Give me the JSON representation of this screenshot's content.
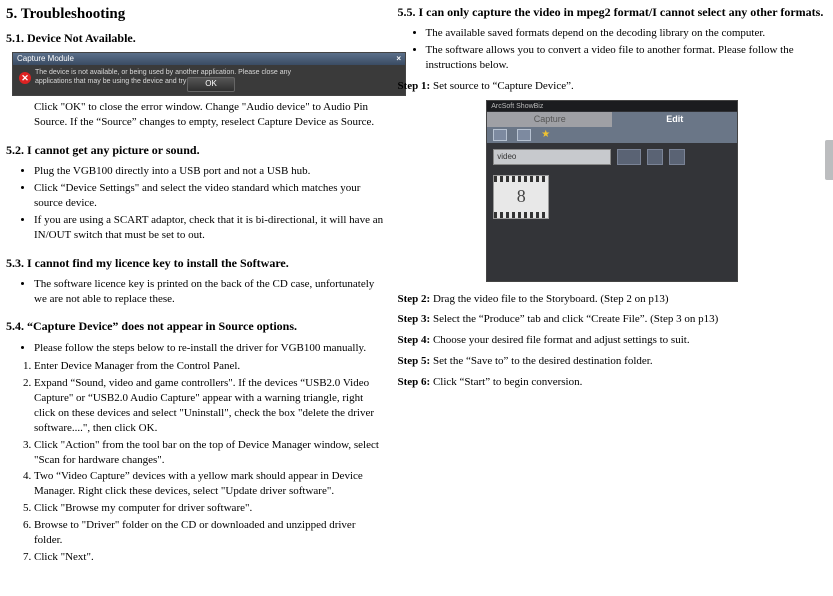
{
  "chapter_title": "5. Troubleshooting",
  "s51": {
    "heading": "5.1. Device Not Available.",
    "shot": {
      "title": "Capture Module",
      "msg_text": "The device is not available, or being used by another application. Please close any applications that may be using the device and try again.",
      "ok": "OK"
    },
    "text": "Click \"OK\" to close the error window. Change \"Audio device\" to Audio Pin Source. If the “Source” changes to empty, reselect Capture Device as Source."
  },
  "s52": {
    "heading": "5.2. I cannot get any picture or sound.",
    "b1": "Plug the VGB100 directly into a USB port and not a USB hub.",
    "b2": "Click “Device Settings\" and select the video standard which matches your source device.",
    "b3": "If you are using a SCART adaptor, check that it is bi-directional, it will have an IN/OUT switch that must be set to out."
  },
  "s53": {
    "heading": "5.3. I cannot find my licence key to install the Software.",
    "b1": "The software licence key is printed on the back of the CD case, unfortunately we are not able to replace these."
  },
  "s54": {
    "heading": "5.4. “Capture Device” does not appear in Source options.",
    "b1": "Please follow the steps below to re-install the driver for VGB100 manually.",
    "n1": "Enter Device Manager from the Control Panel.",
    "n2": "Expand “Sound, video and game controllers\". If the devices “USB2.0 Video Capture\" or “USB2.0 Audio Capture\" appear with a warning triangle, right click on these devices and select \"Uninstall\", check the box \"delete the driver software....\", then click OK.",
    "n3": "Click \"Action\" from the tool bar on the top of Device Manager window, select \"Scan for hardware changes\".",
    "n4": "Two “Video Capture” devices with a yellow mark should appear in Device Manager. Right click these devices, select \"Update driver software\".",
    "n5": "Click \"Browse my computer for driver software\".",
    "n6": "Browse to \"Driver\" folder on the CD or downloaded and unzipped driver folder.",
    "n7": "Click \"Next\"."
  },
  "s55": {
    "heading": "5.5. I can only capture the video in mpeg2 format/I cannot select any other formats.",
    "b1": "The available saved formats depend on the decoding library on the computer.",
    "b2": "The software allows you to convert a video file to another format. Please follow the instructions below.",
    "step1_label": "Step 1:",
    "step1_text": "Set source to “Capture Device”.",
    "app": {
      "title": "ArcSoft ShowBiz",
      "tab1": "Capture",
      "tab2": "Edit",
      "source_value": "video",
      "clip_number": "8"
    },
    "step2_label": "Step 2:",
    "step2_text": "Drag the video file to the Storyboard. (Step 2 on p13)",
    "step3_label": "Step 3:",
    "step3_text": "Select the “Produce” tab and click “Create File”. (Step 3 on p13)",
    "step4_label": "Step 4:",
    "step4_text": "Choose your desired file format and adjust settings to suit.",
    "step5_label": "Step 5:",
    "step5_text": "Set the “Save to” to the desired destination folder.",
    "step6_label": "Step 6:",
    "step6_text": "Click “Start” to begin conversion."
  }
}
